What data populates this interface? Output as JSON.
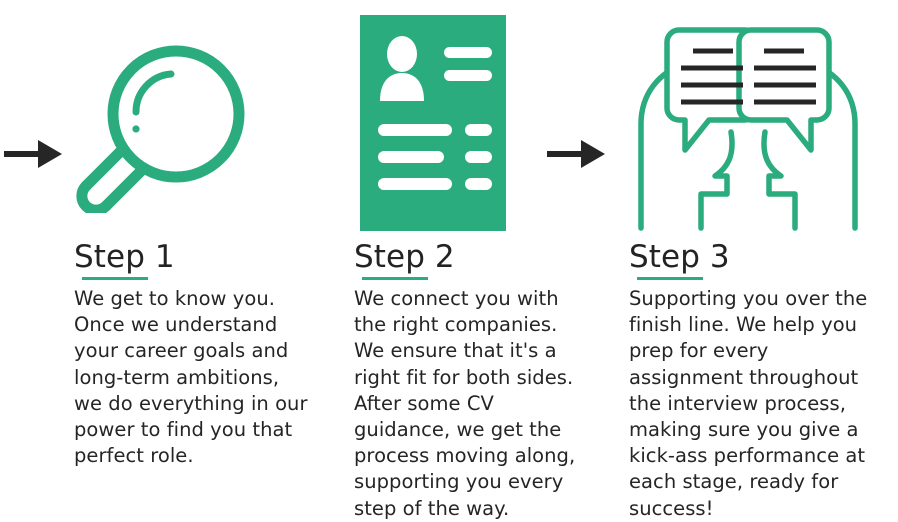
{
  "theme": {
    "accent_green": "#2BAC7E",
    "arrow_color": "#262626",
    "text_color": "#232323",
    "background": "#FFFFFF"
  },
  "steps": [
    {
      "icon": "magnifying-glass-icon",
      "title": "Step 1",
      "body": "We get to know you. Once we understand your career goals and long-term ambitions, we do everything in our power to find you that perfect role."
    },
    {
      "icon": "cv-document-icon",
      "title": "Step 2",
      "body": "We connect you with the right companies. We ensure that it's a right fit for both sides. After some CV guidance, we get the process moving along, supporting you every step of the way."
    },
    {
      "icon": "two-people-talking-icon",
      "title": "Step 3",
      "body": "Supporting you over the finish line. We help you prep for every assignment throughout the interview process, making sure you give a kick-ass performance at each stage, ready for success!"
    }
  ],
  "connectors": [
    {
      "name": "arrow-step1-to-step2"
    },
    {
      "name": "arrow-step2-to-step3"
    }
  ]
}
